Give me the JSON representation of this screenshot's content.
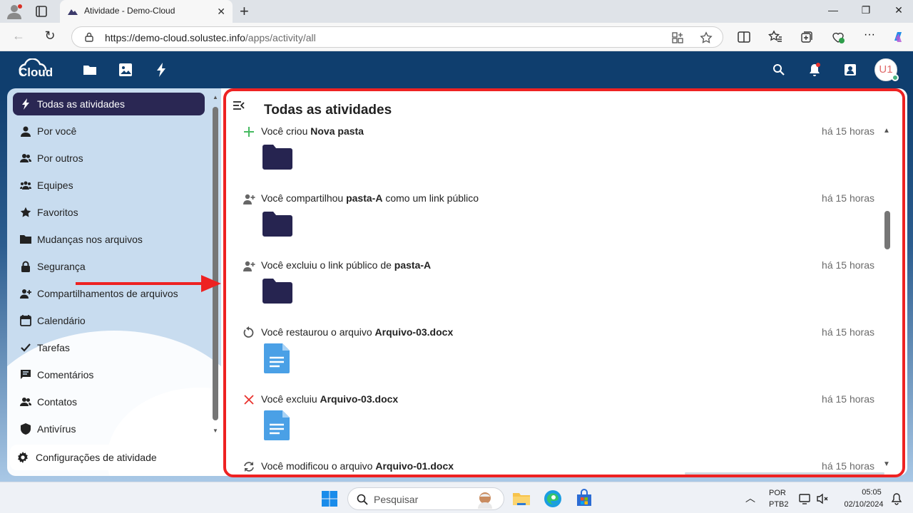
{
  "browser": {
    "tab_title": "Atividade - Demo-Cloud",
    "url_host": "https://demo-cloud.solustec.info",
    "url_path": "/apps/activity/all"
  },
  "header": {
    "logo_text": "Cloud",
    "avatar_initials": "U1"
  },
  "sidebar": {
    "items": [
      {
        "label": "Todas as atividades",
        "icon": "lightning-icon",
        "active": true
      },
      {
        "label": "Por você",
        "icon": "user-icon"
      },
      {
        "label": "Por outros",
        "icon": "users-icon"
      },
      {
        "label": "Equipes",
        "icon": "teams-icon"
      },
      {
        "label": "Favoritos",
        "icon": "star-icon"
      },
      {
        "label": "Mudanças nos arquivos",
        "icon": "folder-icon"
      },
      {
        "label": "Segurança",
        "icon": "lock-icon"
      },
      {
        "label": "Compartilhamentos de arquivos",
        "icon": "share-icon"
      },
      {
        "label": "Calendário",
        "icon": "calendar-icon"
      },
      {
        "label": "Tarefas",
        "icon": "check-icon"
      },
      {
        "label": "Comentários",
        "icon": "comment-icon"
      },
      {
        "label": "Contatos",
        "icon": "contacts-icon"
      },
      {
        "label": "Antivírus",
        "icon": "shield-icon"
      }
    ],
    "settings_label": "Configurações de atividade"
  },
  "main": {
    "title": "Todas as atividades",
    "activities": [
      {
        "pre": "Você criou ",
        "bold": "Nova pasta",
        "post": "",
        "time": "há 15 horas",
        "icon": "plus-icon",
        "thumb": "folder"
      },
      {
        "pre": "Você compartilhou ",
        "bold": "pasta-A",
        "post": " como um link público",
        "time": "há 15 horas",
        "icon": "share-icon",
        "thumb": "folder"
      },
      {
        "pre": "Você excluiu o link público de ",
        "bold": "pasta-A",
        "post": "",
        "time": "há 15 horas",
        "icon": "share-icon",
        "thumb": "folder"
      },
      {
        "pre": "Você restaurou o arquivo ",
        "bold": "Arquivo-03.docx",
        "post": "",
        "time": "há 15 horas",
        "icon": "restore-icon",
        "thumb": "doc"
      },
      {
        "pre": "Você excluiu ",
        "bold": "Arquivo-03.docx",
        "post": "",
        "time": "há 15 horas",
        "icon": "delete-icon",
        "thumb": "doc"
      },
      {
        "pre": "Você modificou o arquivo ",
        "bold": "Arquivo-01.docx",
        "post": "",
        "time": "há 15 horas",
        "icon": "modify-icon",
        "thumb": "doc"
      }
    ]
  },
  "taskbar": {
    "search_placeholder": "Pesquisar",
    "lang_top": "POR",
    "lang_bottom": "PTB2",
    "time": "05:05",
    "date": "02/10/2024"
  },
  "colors": {
    "header_bg": "#0f3e6e",
    "active_nav": "#2a2753",
    "highlight_border": "#ee2222",
    "folder": "#262450",
    "doc": "#4aa0e6"
  }
}
